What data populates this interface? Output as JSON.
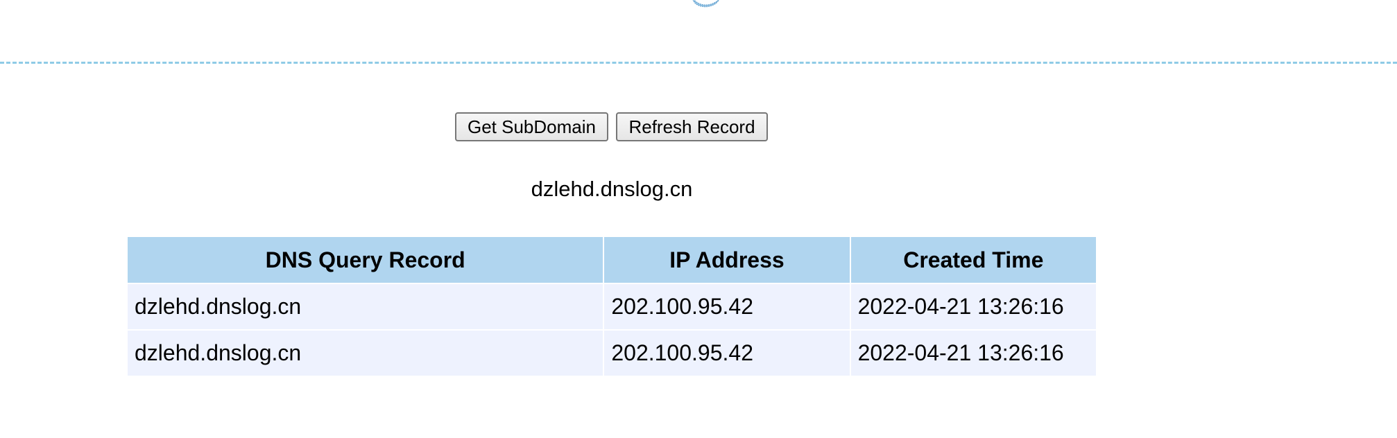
{
  "header": {
    "logo_icon": "dnslog-logo-icon"
  },
  "divider_color": "#8fcbe6",
  "actions": {
    "get_subdomain_label": "Get SubDomain",
    "refresh_record_label": "Refresh Record"
  },
  "subdomain": "dzlehd.dnslog.cn",
  "table": {
    "header_color": "#b0d5ef",
    "row_color": "#eef2fe",
    "columns": [
      "DNS Query Record",
      "IP Address",
      "Created Time"
    ],
    "rows": [
      [
        "dzlehd.dnslog.cn",
        "202.100.95.42",
        "2022-04-21 13:26:16"
      ],
      [
        "dzlehd.dnslog.cn",
        "202.100.95.42",
        "2022-04-21 13:26:16"
      ]
    ]
  }
}
